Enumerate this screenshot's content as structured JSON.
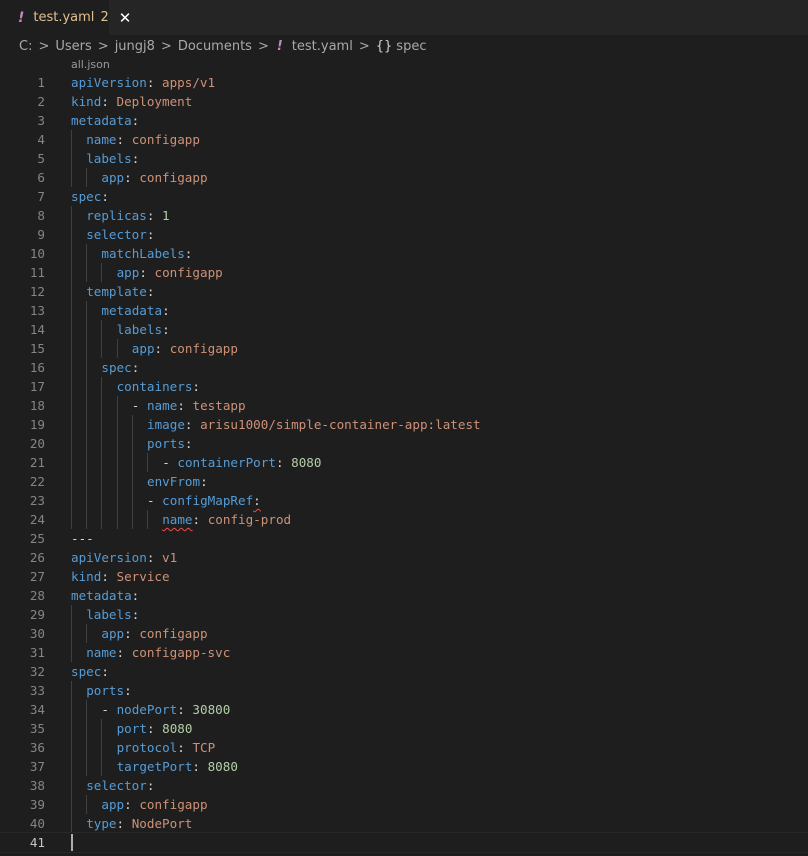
{
  "tab": {
    "name": "test.yaml",
    "badge": "2",
    "bang": "!",
    "close": "✕"
  },
  "breadcrumb": {
    "items": [
      "C:",
      "Users",
      "jungj8",
      "Documents"
    ],
    "file": "test.yaml",
    "symbol_icon": "{}",
    "symbol": "spec",
    "sep": ">"
  },
  "codelens": "all.json",
  "lines": [
    {
      "n": "1",
      "indent": 0,
      "t": [
        [
          "k",
          "apiVersion"
        ],
        [
          "p",
          ": "
        ],
        [
          "v",
          "apps/v1"
        ]
      ]
    },
    {
      "n": "2",
      "indent": 0,
      "t": [
        [
          "k",
          "kind"
        ],
        [
          "p",
          ": "
        ],
        [
          "v",
          "Deployment"
        ]
      ]
    },
    {
      "n": "3",
      "indent": 0,
      "t": [
        [
          "k",
          "metadata"
        ],
        [
          "p",
          ":"
        ]
      ]
    },
    {
      "n": "4",
      "indent": 1,
      "t": [
        [
          "k",
          "name"
        ],
        [
          "p",
          ": "
        ],
        [
          "v",
          "configapp"
        ]
      ]
    },
    {
      "n": "5",
      "indent": 1,
      "t": [
        [
          "k",
          "labels"
        ],
        [
          "p",
          ":"
        ]
      ]
    },
    {
      "n": "6",
      "indent": 2,
      "t": [
        [
          "k",
          "app"
        ],
        [
          "p",
          ": "
        ],
        [
          "v",
          "configapp"
        ]
      ]
    },
    {
      "n": "7",
      "indent": 0,
      "t": [
        [
          "k",
          "spec"
        ],
        [
          "p",
          ":"
        ]
      ]
    },
    {
      "n": "8",
      "indent": 1,
      "t": [
        [
          "k",
          "replicas"
        ],
        [
          "p",
          ": "
        ],
        [
          "n",
          "1"
        ]
      ]
    },
    {
      "n": "9",
      "indent": 1,
      "t": [
        [
          "k",
          "selector"
        ],
        [
          "p",
          ":"
        ]
      ]
    },
    {
      "n": "10",
      "indent": 2,
      "t": [
        [
          "k",
          "matchLabels"
        ],
        [
          "p",
          ":"
        ]
      ]
    },
    {
      "n": "11",
      "indent": 3,
      "t": [
        [
          "k",
          "app"
        ],
        [
          "p",
          ": "
        ],
        [
          "v",
          "configapp"
        ]
      ]
    },
    {
      "n": "12",
      "indent": 1,
      "t": [
        [
          "k",
          "template"
        ],
        [
          "p",
          ":"
        ]
      ]
    },
    {
      "n": "13",
      "indent": 2,
      "t": [
        [
          "k",
          "metadata"
        ],
        [
          "p",
          ":"
        ]
      ]
    },
    {
      "n": "14",
      "indent": 3,
      "t": [
        [
          "k",
          "labels"
        ],
        [
          "p",
          ":"
        ]
      ]
    },
    {
      "n": "15",
      "indent": 4,
      "t": [
        [
          "k",
          "app"
        ],
        [
          "p",
          ": "
        ],
        [
          "v",
          "configapp"
        ]
      ]
    },
    {
      "n": "16",
      "indent": 2,
      "t": [
        [
          "k",
          "spec"
        ],
        [
          "p",
          ":"
        ]
      ]
    },
    {
      "n": "17",
      "indent": 3,
      "t": [
        [
          "k",
          "containers"
        ],
        [
          "p",
          ":"
        ]
      ]
    },
    {
      "n": "18",
      "indent": 4,
      "t": [
        [
          "p",
          "- "
        ],
        [
          "k",
          "name"
        ],
        [
          "p",
          ": "
        ],
        [
          "v",
          "testapp"
        ]
      ]
    },
    {
      "n": "19",
      "indent": 5,
      "t": [
        [
          "k",
          "image"
        ],
        [
          "p",
          ": "
        ],
        [
          "v",
          "arisu1000/simple-container-app:latest"
        ]
      ]
    },
    {
      "n": "20",
      "indent": 5,
      "t": [
        [
          "k",
          "ports"
        ],
        [
          "p",
          ":"
        ]
      ]
    },
    {
      "n": "21",
      "indent": 6,
      "t": [
        [
          "p",
          "- "
        ],
        [
          "k",
          "containerPort"
        ],
        [
          "p",
          ": "
        ],
        [
          "n",
          "8080"
        ]
      ]
    },
    {
      "n": "22",
      "indent": 5,
      "t": [
        [
          "k",
          "envFrom"
        ],
        [
          "p",
          ":"
        ]
      ]
    },
    {
      "n": "23",
      "indent": 5,
      "t": [
        [
          "p",
          "- "
        ],
        [
          "k",
          "configMapRef"
        ],
        [
          "ps",
          ":"
        ]
      ]
    },
    {
      "n": "24",
      "indent": 6,
      "t": [
        [
          "ks",
          "name"
        ],
        [
          "p",
          ": "
        ],
        [
          "v",
          "config-prod"
        ]
      ]
    },
    {
      "n": "25",
      "indent": 0,
      "t": [
        [
          "p",
          "---"
        ]
      ]
    },
    {
      "n": "26",
      "indent": 0,
      "t": [
        [
          "k",
          "apiVersion"
        ],
        [
          "p",
          ": "
        ],
        [
          "v",
          "v1"
        ]
      ]
    },
    {
      "n": "27",
      "indent": 0,
      "t": [
        [
          "k",
          "kind"
        ],
        [
          "p",
          ": "
        ],
        [
          "v",
          "Service"
        ]
      ]
    },
    {
      "n": "28",
      "indent": 0,
      "t": [
        [
          "k",
          "metadata"
        ],
        [
          "p",
          ":"
        ]
      ]
    },
    {
      "n": "29",
      "indent": 1,
      "t": [
        [
          "k",
          "labels"
        ],
        [
          "p",
          ":"
        ]
      ]
    },
    {
      "n": "30",
      "indent": 2,
      "t": [
        [
          "k",
          "app"
        ],
        [
          "p",
          ": "
        ],
        [
          "v",
          "configapp"
        ]
      ]
    },
    {
      "n": "31",
      "indent": 1,
      "t": [
        [
          "k",
          "name"
        ],
        [
          "p",
          ": "
        ],
        [
          "v",
          "configapp-svc"
        ]
      ]
    },
    {
      "n": "32",
      "indent": 0,
      "t": [
        [
          "k",
          "spec"
        ],
        [
          "p",
          ":"
        ]
      ]
    },
    {
      "n": "33",
      "indent": 1,
      "t": [
        [
          "k",
          "ports"
        ],
        [
          "p",
          ":"
        ]
      ]
    },
    {
      "n": "34",
      "indent": 2,
      "t": [
        [
          "p",
          "- "
        ],
        [
          "k",
          "nodePort"
        ],
        [
          "p",
          ": "
        ],
        [
          "n",
          "30800"
        ]
      ]
    },
    {
      "n": "35",
      "indent": 3,
      "t": [
        [
          "k",
          "port"
        ],
        [
          "p",
          ": "
        ],
        [
          "n",
          "8080"
        ]
      ]
    },
    {
      "n": "36",
      "indent": 3,
      "t": [
        [
          "k",
          "protocol"
        ],
        [
          "p",
          ": "
        ],
        [
          "v",
          "TCP"
        ]
      ]
    },
    {
      "n": "37",
      "indent": 3,
      "t": [
        [
          "k",
          "targetPort"
        ],
        [
          "p",
          ": "
        ],
        [
          "n",
          "8080"
        ]
      ]
    },
    {
      "n": "38",
      "indent": 1,
      "t": [
        [
          "k",
          "selector"
        ],
        [
          "p",
          ":"
        ]
      ]
    },
    {
      "n": "39",
      "indent": 2,
      "t": [
        [
          "k",
          "app"
        ],
        [
          "p",
          ": "
        ],
        [
          "v",
          "configapp"
        ]
      ]
    },
    {
      "n": "40",
      "indent": 1,
      "t": [
        [
          "k",
          "type"
        ],
        [
          "p",
          ": "
        ],
        [
          "v",
          "NodePort"
        ]
      ]
    },
    {
      "n": "41",
      "indent": 0,
      "t": [],
      "current": true
    }
  ]
}
